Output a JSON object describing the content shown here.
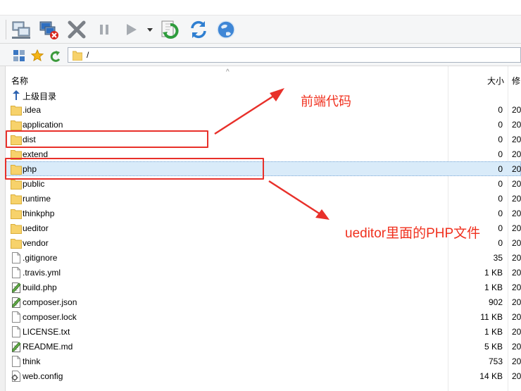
{
  "toolbar": {
    "buttons": [
      {
        "name": "connect-icon"
      },
      {
        "name": "disconnect-icon"
      },
      {
        "name": "cancel-icon"
      },
      {
        "name": "pause-icon"
      },
      {
        "name": "run-icon"
      },
      {
        "name": "run-dropdown-icon"
      },
      {
        "name": "sync-icon"
      },
      {
        "name": "refresh-icon"
      },
      {
        "name": "globe-icon"
      }
    ]
  },
  "address": {
    "path": "/"
  },
  "columns": {
    "name": "名称",
    "size": "大小",
    "modified": "修"
  },
  "rows": [
    {
      "name": "上级目录",
      "size": "",
      "modified": "",
      "type": "up"
    },
    {
      "name": ".idea",
      "size": "0",
      "modified": "20",
      "type": "folder"
    },
    {
      "name": "application",
      "size": "0",
      "modified": "20",
      "type": "folder"
    },
    {
      "name": "dist",
      "size": "0",
      "modified": "20",
      "type": "folder"
    },
    {
      "name": "extend",
      "size": "0",
      "modified": "20",
      "type": "folder"
    },
    {
      "name": "php",
      "size": "0",
      "modified": "20",
      "type": "folder",
      "selected": true
    },
    {
      "name": "public",
      "size": "0",
      "modified": "20",
      "type": "folder"
    },
    {
      "name": "runtime",
      "size": "0",
      "modified": "20",
      "type": "folder"
    },
    {
      "name": "thinkphp",
      "size": "0",
      "modified": "20",
      "type": "folder"
    },
    {
      "name": "ueditor",
      "size": "0",
      "modified": "20",
      "type": "folder"
    },
    {
      "name": "vendor",
      "size": "0",
      "modified": "20",
      "type": "folder"
    },
    {
      "name": ".gitignore",
      "size": "35",
      "modified": "20",
      "type": "file"
    },
    {
      "name": ".travis.yml",
      "size": "1 KB",
      "modified": "20",
      "type": "file"
    },
    {
      "name": "build.php",
      "size": "1 KB",
      "modified": "20",
      "type": "script"
    },
    {
      "name": "composer.json",
      "size": "902",
      "modified": "20",
      "type": "script"
    },
    {
      "name": "composer.lock",
      "size": "11 KB",
      "modified": "20",
      "type": "file"
    },
    {
      "name": "LICENSE.txt",
      "size": "1 KB",
      "modified": "20",
      "type": "file"
    },
    {
      "name": "README.md",
      "size": "5 KB",
      "modified": "20",
      "type": "script"
    },
    {
      "name": "think",
      "size": "753",
      "modified": "20",
      "type": "file"
    },
    {
      "name": "web.config",
      "size": "14 KB",
      "modified": "20",
      "type": "config"
    }
  ],
  "annotations": {
    "frontend_label": "前端代码",
    "ueditor_label": "ueditor里面的PHP文件",
    "color": "#f0301e"
  },
  "colors": {
    "selection": "#d9ebf9",
    "folder": "#f7d26b",
    "highlight_box": "#e8302a"
  }
}
